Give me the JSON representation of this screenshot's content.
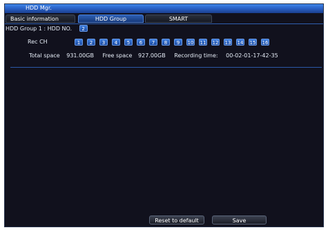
{
  "window": {
    "title": "HDD Mgr."
  },
  "tabs": [
    {
      "label": "Basic information",
      "active": false
    },
    {
      "label": "HDD Group",
      "active": true
    },
    {
      "label": "SMART",
      "active": false
    }
  ],
  "group": {
    "label": "HDD Group 1 :  HDD NO.",
    "hdd_no": "2"
  },
  "rec_ch": {
    "label": "Rec CH",
    "channels": [
      "1",
      "2",
      "3",
      "4",
      "5",
      "6",
      "7",
      "8",
      "9",
      "10",
      "11",
      "12",
      "13",
      "14",
      "15",
      "16"
    ]
  },
  "stats": {
    "total_label": "Total space",
    "total_value": "931.00GB",
    "free_label": "Free space",
    "free_value": "927.00GB",
    "time_label": "Recording time:",
    "time_value": "00-02-01-17-42-35"
  },
  "buttons": {
    "reset": "Reset to default",
    "save": "Save"
  },
  "colors": {
    "background": "#11111d",
    "titlebar": "#2b63c8",
    "channel_button": "#2a5fc0",
    "divider": "#2a58a8"
  }
}
